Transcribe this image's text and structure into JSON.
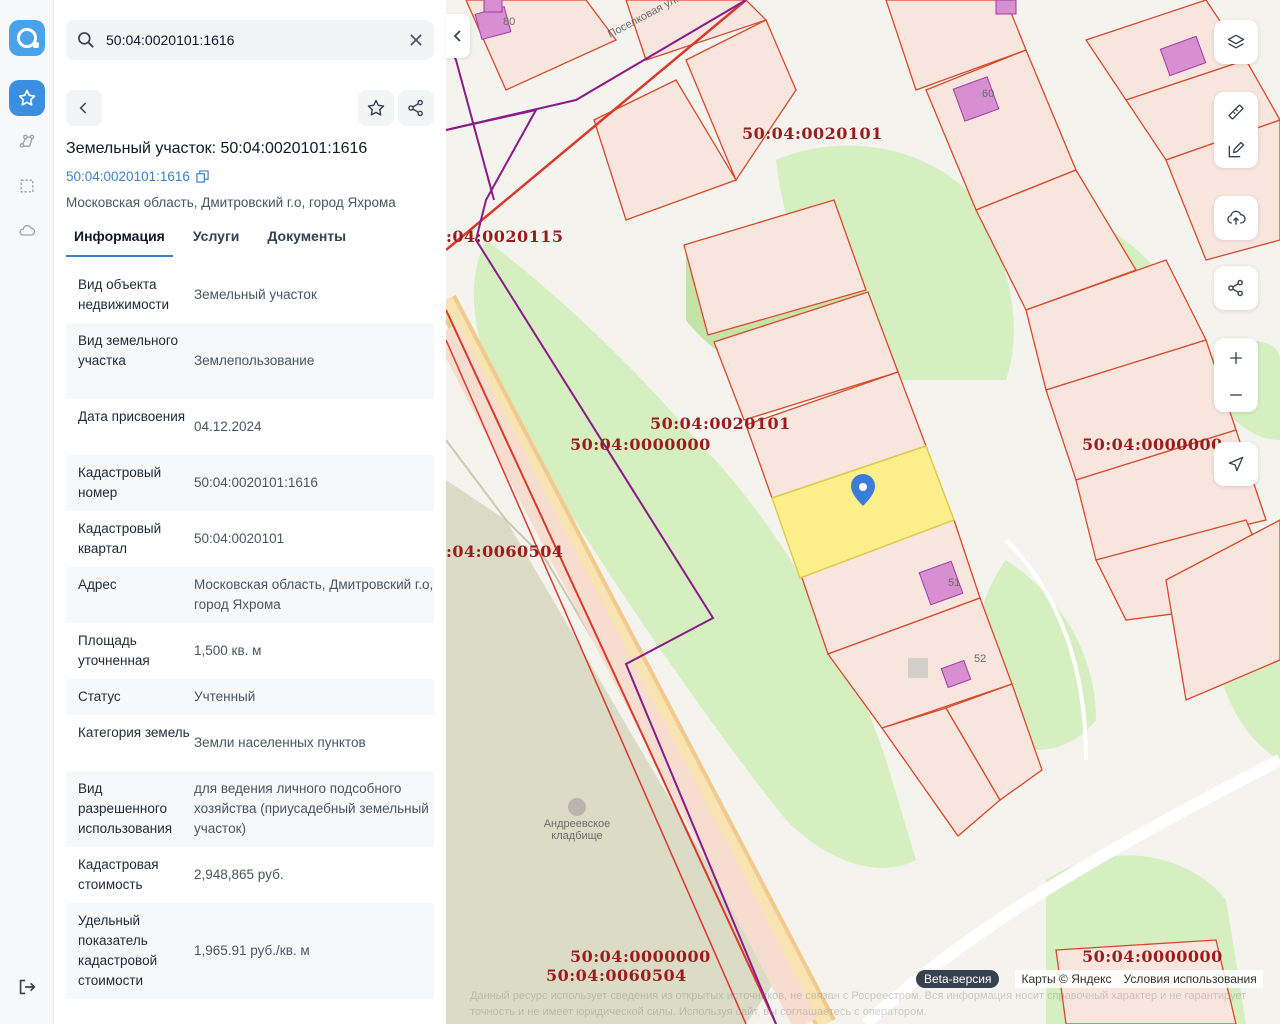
{
  "search": {
    "value": "50:04:0020101:1616"
  },
  "object": {
    "title": "Земельный участок: 50:04:0020101:1616",
    "cadastral_link": "50:04:0020101:1616",
    "address": "Московская область, Дмитровский г.о, город Яхрома"
  },
  "tabs": [
    "Информация",
    "Услуги",
    "Документы"
  ],
  "properties": [
    {
      "key": "Вид объекта недвижимости",
      "value": "Земельный участок"
    },
    {
      "key": "Вид земельного участка",
      "value": "Землепользование"
    },
    {
      "key": "Дата присвоения",
      "value": "04.12.2024"
    },
    {
      "key": "Кадастровый номер",
      "value": "50:04:0020101:1616"
    },
    {
      "key": "Кадастровый квартал",
      "value": "50:04:0020101"
    },
    {
      "key": "Адрес",
      "value": "Московская область, Дмитровский г.о, город Яхрома"
    },
    {
      "key": "Площадь уточненная",
      "value": "1,500 кв. м"
    },
    {
      "key": "Статус",
      "value": "Учтенный"
    },
    {
      "key": "Категория земель",
      "value": "Земли населенных пунктов"
    },
    {
      "key": "Вид разрешенного использования",
      "value": "для ведения личного подсобного хозяйства (приусадебный земельный участок)"
    },
    {
      "key": "Кадастровая стоимость",
      "value": "2,948,865 руб."
    },
    {
      "key": "Удельный показатель кадастровой стоимости",
      "value": "1,965.91 руб./кв. м"
    }
  ],
  "map": {
    "quarter_labels": [
      "50:04:0020101",
      ":04:0020115",
      "50:04:0020101",
      "50:04:0000000",
      "50:04:0000000",
      ":04:0060504",
      "50:04:0000000",
      "50:04:0060504",
      "50:04:0000000"
    ],
    "plot_numbers": [
      "80",
      "60",
      "51",
      "52"
    ],
    "street": "Поселковая ул.",
    "poi": "Андреевское кладбище",
    "footer": {
      "beta": "Beta-версия",
      "copyright": "Карты © Яндекс",
      "terms": "Условия использования"
    },
    "disclaimer": "Данный ресурс использует сведения из открытых источников, не связан с Росреестром. Вся информация носит справочный характер и не гарантирует точность и не имеет юридической силы. Используя сайт, вы соглашаетесь с оператором."
  },
  "colors": {
    "accent": "#3b8ee0",
    "parcel_border": "#d9482b",
    "selected_parcel": "#fbef8c",
    "boundary": "#8b1a8b",
    "label": "#9b1c1c"
  }
}
